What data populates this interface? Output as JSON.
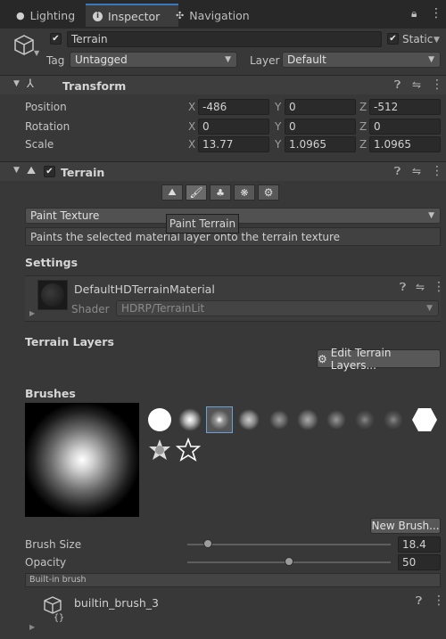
{
  "tabs": [
    {
      "label": "Lighting",
      "icon": "bulb-icon"
    },
    {
      "label": "Inspector",
      "icon": "info-icon"
    },
    {
      "label": "Navigation",
      "icon": "navigation-icon"
    }
  ],
  "object": {
    "name": "Terrain",
    "active": true,
    "static_label": "Static",
    "static": true
  },
  "tag": {
    "label": "Tag",
    "value": "Untagged"
  },
  "layer": {
    "label": "Layer",
    "value": "Default"
  },
  "transform": {
    "title": "Transform",
    "position": {
      "label": "Position",
      "x": "-486",
      "y": "0",
      "z": "-512"
    },
    "rotation": {
      "label": "Rotation",
      "x": "0",
      "y": "0",
      "z": "0"
    },
    "scale": {
      "label": "Scale",
      "x": "13.77",
      "y": "1.0965",
      "z": "1.0965"
    },
    "axis": {
      "x": "X",
      "y": "Y",
      "z": "Z"
    }
  },
  "terrain": {
    "title": "Terrain",
    "enabled": true,
    "tools": [
      "raise-terrain-tool",
      "paint-terrain-tool",
      "place-trees-tool",
      "paint-details-tool",
      "terrain-settings-tool"
    ],
    "active_tool": 1,
    "tooltip": "Paint Terrain",
    "mode": "Paint Texture",
    "description": "Paints the selected material layer onto the terrain texture"
  },
  "settings": {
    "title": "Settings",
    "material_name": "DefaultHDTerrainMaterial",
    "shader_label": "Shader",
    "shader_value": "HDRP/TerrainLit"
  },
  "terrain_layers": {
    "title": "Terrain Layers",
    "edit_button": "Edit Terrain Layers..."
  },
  "brushes": {
    "title": "Brushes",
    "new_button": "New Brush...",
    "selected_index": 2,
    "size_label": "Brush Size",
    "size_value": "18.4",
    "size_fraction": 0.1,
    "opacity_label": "Opacity",
    "opacity_value": "50",
    "opacity_fraction": 0.5,
    "builtin_label": "Built-in brush",
    "asset_name": "builtin_brush_3"
  },
  "colors": {
    "accent": "#3a79bb",
    "background": "#383838",
    "header": "#3e3e3e"
  }
}
